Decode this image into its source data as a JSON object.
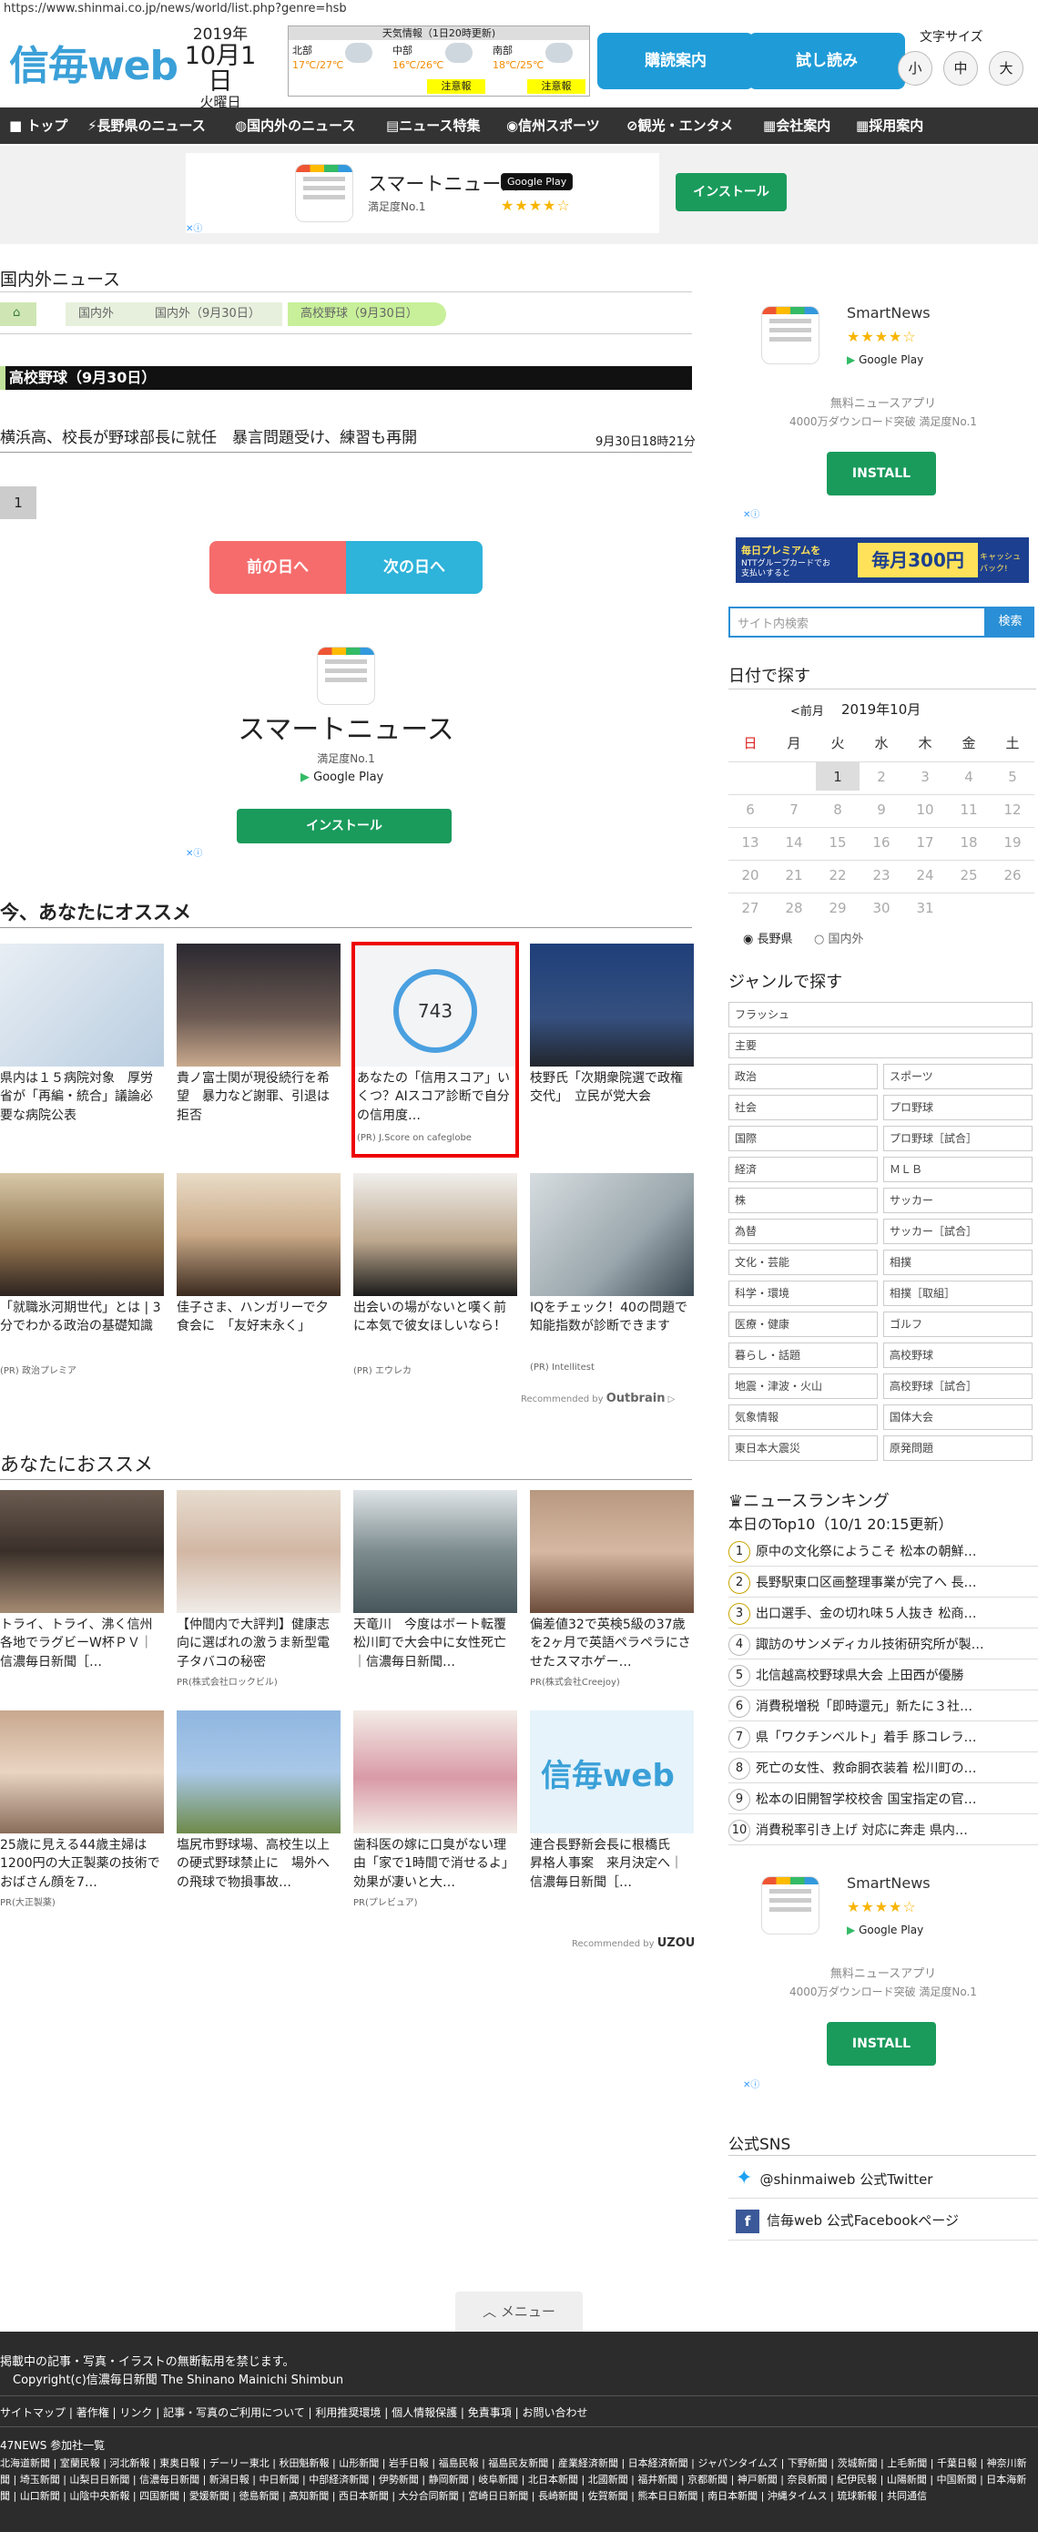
{
  "url": "https://www.shinmai.co.jp/news/world/list.php?genre=hsb",
  "header": {
    "logo": "信毎web",
    "year": "2019年",
    "date": "10月1日",
    "weekday": "火曜日",
    "weather": {
      "title": "天気情報（1日20時更新)",
      "areas": [
        {
          "name": "北部",
          "temp": "17℃/27℃",
          "alert": ""
        },
        {
          "name": "中部",
          "temp": "16℃/26℃",
          "alert": "注意報"
        },
        {
          "name": "南部",
          "temp": "18℃/25℃",
          "alert": "注意報"
        }
      ]
    },
    "subscribe": "購読案内",
    "trial": "試し読み",
    "fontsize_label": "文字サイズ",
    "font_sizes": [
      "小",
      "中",
      "大"
    ]
  },
  "nav": [
    "トップ",
    "長野県のニュース",
    "国内外のニュース",
    "ニュース特集",
    "信州スポーツ",
    "観光・エンタメ",
    "会社案内",
    "採用案内"
  ],
  "ad_top": {
    "name": "スマートニュース",
    "google_play": "Google Play",
    "rating": "満足度No.1",
    "install": "インストール"
  },
  "breadcrumb": {
    "page_title": "国内外ニュース",
    "items": [
      "国内外",
      "国内外（9月30日）",
      "高校野球（9月30日）"
    ]
  },
  "section_header": "高校野球（9月30日）",
  "article": {
    "title": "横浜高、校長が野球部長に就任　暴言問題受け、練習も再開",
    "date": "9月30日18時21分"
  },
  "page_number": "1",
  "day_nav": {
    "prev": "前の日へ",
    "next": "次の日へ"
  },
  "ad_mid": {
    "name": "スマートニュース",
    "rating": "満足度No.1",
    "google_play": "Google Play",
    "install": "インストール"
  },
  "recommend1": {
    "title": "今、あなたにオススメ",
    "items": [
      {
        "caption": "県内は１５病院対象　厚労省が「再編・統合」議論必要な病院公表",
        "source": ""
      },
      {
        "caption": "貴ノ富士関が現役続行を希望　暴力など謝罪、引退は拒否",
        "source": ""
      },
      {
        "caption": "あなたの「信用スコア」いくつ？AIスコア診断で自分の信用度…",
        "source": "(PR) J.Score on cafeglobe"
      },
      {
        "caption": "枝野氏「次期衆院選で政権交代」　立民が党大会",
        "source": ""
      },
      {
        "caption": "「就職氷河期世代」とは | 3分でわかる政治の基礎知識",
        "source": "(PR) 政治プレミア"
      },
      {
        "caption": "佳子さま、ハンガリーで夕食会に　「友好末永く」",
        "source": ""
      },
      {
        "caption": "出会いの場がないと嘆く前に本気で彼女ほしいなら！",
        "source": "(PR) エウレカ"
      },
      {
        "caption": "IQをチェック！40の問題で知能指数が診断できます",
        "source": "(PR) Intellitest"
      }
    ],
    "recommended_by": "Recommended by",
    "outbrain": "Outbrain",
    "score": "743"
  },
  "recommend2": {
    "title": "あなたにおススメ",
    "items": [
      {
        "caption": "トライ、トライ、沸く信州　各地でラグビーW杯ＰＶ｜信濃毎日新聞［…",
        "source": ""
      },
      {
        "caption": "【仲間内で大評判】健康志向に選ばれの激うま新型電子タバコの秘密",
        "source": "PR(株式会社ロックビル)"
      },
      {
        "caption": "天竜川　今度はボート転覆　松川町で大会中に女性死亡｜信濃毎日新聞…",
        "source": ""
      },
      {
        "caption": "偏差値32で英検5級の37歳を2ヶ月で英語ペラペラにさせたスマホゲー…",
        "source": "PR(株式会社Creejoy)"
      },
      {
        "caption": "25歳に見える44歳主婦は1200円の大正製薬の技術でおばさん顔を7…",
        "source": "PR(大正製薬)"
      },
      {
        "caption": "塩尻市野球場、高校生以上の硬式野球禁止に　場外への飛球で物損事故…",
        "source": ""
      },
      {
        "caption": "歯科医の嫁に口臭がない理由「家で1時間で消せるよ」効果が凄いと大…",
        "source": "PR(プレビュア)"
      },
      {
        "caption": "連合長野新会長に根橋氏　昇格人事案　来月決定へ｜信濃毎日新聞［…",
        "source": ""
      }
    ],
    "recommended_by": "Recommended by",
    "uzou": "UZOU",
    "logo_text": "信毎web"
  },
  "sidebar": {
    "smartnews": {
      "name": "SmartNews",
      "google_play": "Google Play",
      "tag": "無料ニュースアプリ",
      "sub": "4000万ダウンロード突破 満足度No.1",
      "install": "INSTALL"
    },
    "banner": {
      "left": "毎日プレミアムを",
      "mid": "NTTグループカードでお支払いすると",
      "right": "毎月300円",
      "tail": "キャッシュバック!"
    },
    "search": {
      "placeholder": "サイト内検索",
      "button": "検索"
    },
    "date_search": {
      "title": "日付で探す",
      "prev": "<前月",
      "month": "2019年10月",
      "days": [
        "日",
        "月",
        "火",
        "水",
        "木",
        "金",
        "土"
      ],
      "cells": [
        "",
        "",
        "1",
        "2",
        "3",
        "4",
        "5",
        "6",
        "7",
        "8",
        "9",
        "10",
        "11",
        "12",
        "13",
        "14",
        "15",
        "16",
        "17",
        "18",
        "19",
        "20",
        "21",
        "22",
        "23",
        "24",
        "25",
        "26",
        "27",
        "28",
        "29",
        "30",
        "31",
        "",
        ""
      ],
      "radio1": "長野県",
      "radio2": "国内外"
    },
    "genre": {
      "title": "ジャンルで探す",
      "full": [
        "フラッシュ",
        "主要"
      ],
      "pairs": [
        [
          "政治",
          "スポーツ"
        ],
        [
          "社会",
          "プロ野球"
        ],
        [
          "国際",
          "プロ野球［試合］"
        ],
        [
          "経済",
          "ＭＬＢ"
        ],
        [
          "株",
          "サッカー"
        ],
        [
          "為替",
          "サッカー［試合］"
        ],
        [
          "文化・芸能",
          "相撲"
        ],
        [
          "科学・環境",
          "相撲［取組］"
        ],
        [
          "医療・健康",
          "ゴルフ"
        ],
        [
          "暮らし・話題",
          "高校野球"
        ],
        [
          "地震・津波・火山",
          "高校野球［試合］"
        ],
        [
          "気象情報",
          "国体大会"
        ],
        [
          "東日本大震災",
          "原発問題"
        ]
      ]
    },
    "ranking": {
      "title": "ニュースランキング",
      "subtitle": "本日のTop10（10/1 20:15更新）",
      "items": [
        "原中の文化祭にようこそ 松本の朝鮮…",
        "長野駅東口区画整理事業が完了へ 長…",
        "出口選手、金の切れ味５人抜き 松商…",
        "諏訪のサンメディカル技術研究所が製…",
        "北信越高校野球県大会 上田西が優勝",
        "消費税増税「即時還元」新たに３社…",
        "県「ワクチンベルト」着手 豚コレラ…",
        "死亡の女性、救命胴衣装着 松川町の…",
        "松本の旧開智学校校舎 国宝指定の官…",
        "消費税率引き上げ 対応に奔走 県内…"
      ]
    },
    "smartnews2": {
      "name": "SmartNews",
      "google_play": "Google Play",
      "tag": "無料ニュースアプリ",
      "sub": "4000万ダウンロード突破 満足度No.1",
      "install": "INSTALL"
    },
    "sns": {
      "title": "公式SNS",
      "twitter": "@shinmaiweb 公式Twitter",
      "facebook": "信毎web 公式Facebookページ"
    }
  },
  "menu": "メニュー",
  "footer": {
    "notice": "掲載中の記事・写真・イラストの無断転用を禁じます。",
    "copyright": "Copyright(c)信濃毎日新聞 The Shinano Mainichi Shimbun",
    "links": [
      "サイトマップ",
      "著作権",
      "リンク",
      "記事・写真のご利用について",
      "利用推奨環境",
      "個人情報保護",
      "免責事項",
      "お問い合わせ"
    ],
    "news47_title": "47NEWS 参加社一覧",
    "news47": "北海道新聞 | 室蘭民報 | 河北新報 | 東奥日報 | デーリー東北 | 秋田魁新報 | 山形新聞 | 岩手日報 | 福島民報 | 福島民友新聞 | 産業経済新聞 | 日本経済新聞 | ジャパンタイムズ | 下野新聞 | 茨城新聞 | 上毛新聞 | 千葉日報 | 神奈川新聞 | 埼玉新聞 | 山梨日日新聞 | 信濃毎日新聞 | 新潟日報 | 中日新聞 | 中部経済新聞 | 伊勢新聞 | 静岡新聞 | 岐阜新聞 | 北日本新聞 | 北國新聞 | 福井新聞 | 京都新聞 | 神戸新聞 | 奈良新聞 | 紀伊民報 | 山陽新聞 | 中国新聞 | 日本海新聞 | 山口新聞 | 山陰中央新報 | 四国新聞 | 愛媛新聞 | 徳島新聞 | 高知新聞 | 西日本新聞 | 大分合同新聞 | 宮崎日日新聞 | 長崎新聞 | 佐賀新聞 | 熊本日日新聞 | 南日本新聞 | 沖縄タイムス | 琉球新報 | 共同通信"
  }
}
